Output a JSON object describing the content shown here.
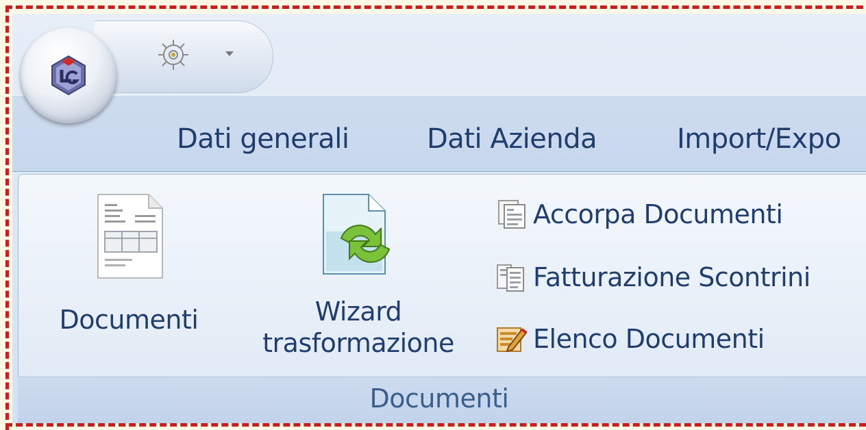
{
  "quick_access": {
    "app_logo": "app-orb-logo-icon",
    "settings_icon": "gear-icon",
    "dropdown_icon": "chevron-down-icon"
  },
  "tabs": [
    {
      "label": "Dati generali"
    },
    {
      "label": "Dati Azienda"
    },
    {
      "label": "Import/Expo"
    }
  ],
  "ribbon": {
    "group_label": "Documenti",
    "big_buttons": [
      {
        "label": "Documenti",
        "icon": "document-table-icon"
      },
      {
        "label_line1": "Wizard",
        "label_line2": "trasformazione",
        "icon": "document-refresh-icon"
      }
    ],
    "small_buttons": [
      {
        "label": "Accorpa Documenti",
        "icon": "merge-documents-icon"
      },
      {
        "label": "Fatturazione Scontrini",
        "icon": "receipts-icon"
      },
      {
        "label": "Elenco Documenti",
        "icon": "edit-list-icon"
      }
    ]
  },
  "colors": {
    "frame_dash": "#c81e1e",
    "text": "#1f3e6e",
    "group_label_text": "#3a5f8f"
  }
}
